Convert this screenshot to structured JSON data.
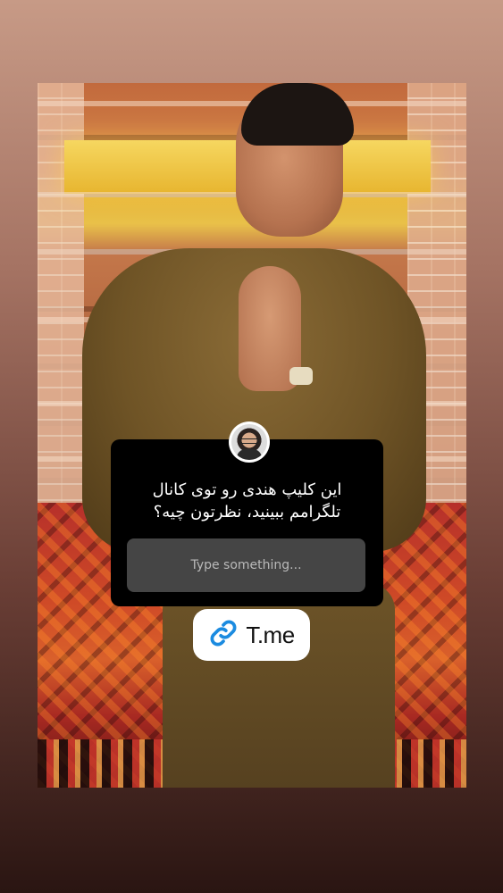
{
  "question": {
    "text": "این کلیپ هندی رو توی کانال تلگرامم ببینید، نظرتون چیه؟",
    "input_placeholder": "Type something..."
  },
  "link": {
    "label": "T.me",
    "icon": "link-icon",
    "icon_color": "#1b8be0"
  }
}
